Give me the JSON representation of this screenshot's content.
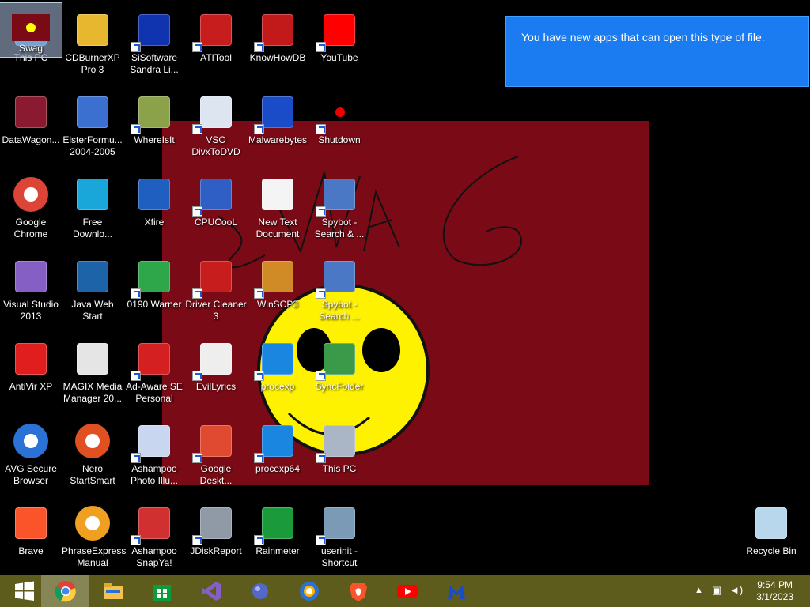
{
  "toast": {
    "message": "You have new apps that can open this type of file."
  },
  "wallpaper": {
    "text": "SWAG"
  },
  "desktop_icons": [
    {
      "label": "This PC",
      "icon": "pc-icon"
    },
    {
      "label": "CDBurnerXP Pro 3",
      "icon": "cdburner-icon"
    },
    {
      "label": "SiSoftware Sandra Li...",
      "icon": "sandra-icon"
    },
    {
      "label": "ATITool",
      "icon": "atitool-icon"
    },
    {
      "label": "KnowHowDB",
      "icon": "knowhowdb-icon"
    },
    {
      "label": "YouTube",
      "icon": "youtube-icon"
    },
    {
      "label": "Swag",
      "icon": "swag-image-icon"
    },
    {
      "label": "DataWagon...",
      "icon": "datawagon-icon"
    },
    {
      "label": "ElsterFormu... 2004-2005",
      "icon": "elster-icon"
    },
    {
      "label": "WhereIsIt",
      "icon": "whereisit-icon"
    },
    {
      "label": "VSO DivxToDVD",
      "icon": "vso-icon"
    },
    {
      "label": "Malwarebytes",
      "icon": "malwarebytes-icon"
    },
    {
      "label": "Shutdown",
      "icon": "shutdown-icon"
    },
    {
      "label": "Google Chrome",
      "icon": "chrome-icon"
    },
    {
      "label": "Free Downlo...",
      "icon": "free-download-icon"
    },
    {
      "label": "Xfire",
      "icon": "xfire-icon"
    },
    {
      "label": "CPUCooL",
      "icon": "cpucool-icon"
    },
    {
      "label": "New Text Document",
      "icon": "text-document-icon"
    },
    {
      "label": "Spybot - Search & ...",
      "icon": "spybot-icon"
    },
    {
      "label": "Visual Studio 2013",
      "icon": "visual-studio-icon"
    },
    {
      "label": "Java Web Start",
      "icon": "java-icon"
    },
    {
      "label": "0190 Warner",
      "icon": "warner-icon"
    },
    {
      "label": "Driver Cleaner 3",
      "icon": "driver-cleaner-icon"
    },
    {
      "label": "WinSCP3",
      "icon": "winscp-icon"
    },
    {
      "label": "Spybot - Search ...",
      "icon": "spybot-icon"
    },
    {
      "label": "AntiVir XP",
      "icon": "antivir-icon"
    },
    {
      "label": "MAGIX Media Manager 20...",
      "icon": "magix-icon"
    },
    {
      "label": "Ad-Aware SE Personal",
      "icon": "adaware-icon"
    },
    {
      "label": "EvilLyrics",
      "icon": "evillyrics-icon"
    },
    {
      "label": "procexp",
      "icon": "procexp-icon"
    },
    {
      "label": "SyncFolder",
      "icon": "syncfolder-icon"
    },
    {
      "label": "AVG Secure Browser",
      "icon": "avg-browser-icon"
    },
    {
      "label": "Nero StartSmart",
      "icon": "nero-icon"
    },
    {
      "label": "Ashampoo Photo Illu...",
      "icon": "ashampoo-photo-icon"
    },
    {
      "label": "Google Deskt...",
      "icon": "google-desktop-icon"
    },
    {
      "label": "procexp64",
      "icon": "procexp-icon"
    },
    {
      "label": "This PC",
      "icon": "pc-settings-icon"
    },
    {
      "label": "Brave",
      "icon": "brave-icon"
    },
    {
      "label": "PhraseExpress Manual",
      "icon": "phraseexpress-icon"
    },
    {
      "label": "Ashampoo SnapYa!",
      "icon": "ashampoo-snap-icon"
    },
    {
      "label": "JDiskReport",
      "icon": "jdiskreport-icon"
    },
    {
      "label": "Rainmeter",
      "icon": "rainmeter-icon"
    },
    {
      "label": "userinit - Shortcut",
      "icon": "userinit-icon"
    },
    {
      "label": "Recycle Bin",
      "icon": "recycle-bin-icon"
    }
  ],
  "taskbar": {
    "pinned": [
      "windows-start-icon",
      "chrome-icon",
      "file-explorer-icon",
      "store-icon",
      "visual-studio-icon",
      "app-icon",
      "avg-browser-icon",
      "brave-icon",
      "youtube-icon",
      "malwarebytes-icon"
    ],
    "time": "9:54 PM",
    "date": "3/1/2023"
  }
}
